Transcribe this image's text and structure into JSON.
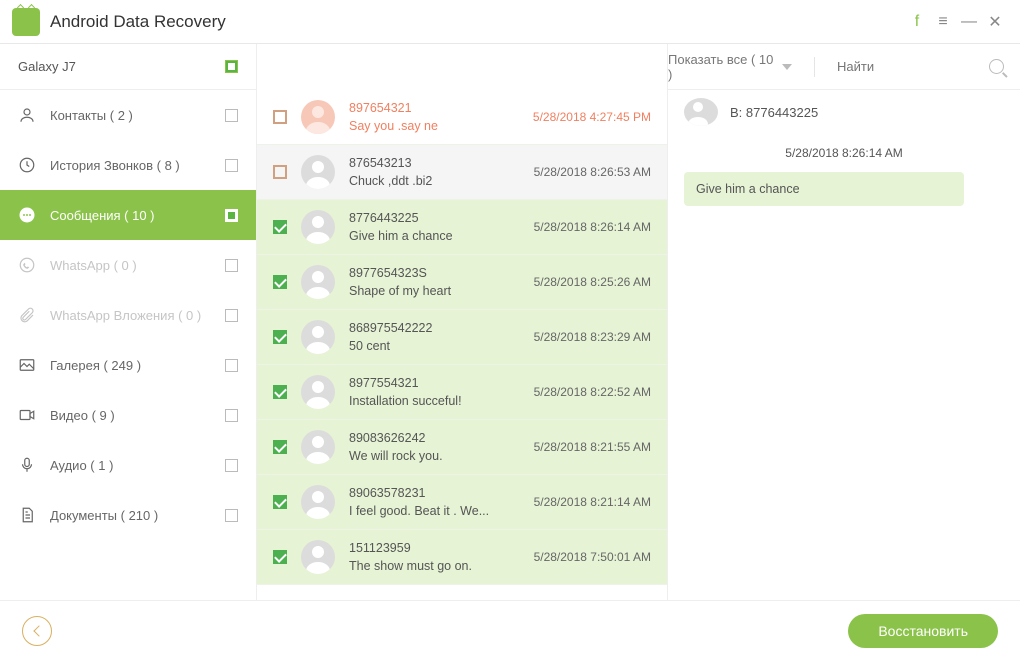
{
  "app": {
    "title": "Android Data Recovery"
  },
  "device": {
    "name": "Galaxy J7"
  },
  "filter": {
    "label": "Показать все ( 10 )"
  },
  "search": {
    "placeholder": "Найти"
  },
  "sidebar": {
    "items": [
      {
        "label": "Контакты ( 2 )",
        "checked": false,
        "disabled": false,
        "icon": "contacts"
      },
      {
        "label": "История Звонков ( 8 )",
        "checked": false,
        "disabled": false,
        "icon": "calllog"
      },
      {
        "label": "Сообщения ( 10 )",
        "checked": true,
        "disabled": false,
        "icon": "messages"
      },
      {
        "label": "WhatsApp ( 0 )",
        "checked": false,
        "disabled": true,
        "icon": "whatsapp"
      },
      {
        "label": "WhatsApp Вложения ( 0 )",
        "checked": false,
        "disabled": true,
        "icon": "attachment"
      },
      {
        "label": "Галерея ( 249 )",
        "checked": false,
        "disabled": false,
        "icon": "gallery"
      },
      {
        "label": "Видео ( 9 )",
        "checked": false,
        "disabled": false,
        "icon": "video"
      },
      {
        "label": "Аудио ( 1 )",
        "checked": false,
        "disabled": false,
        "icon": "audio"
      },
      {
        "label": "Документы ( 210 )",
        "checked": false,
        "disabled": false,
        "icon": "documents"
      }
    ]
  },
  "messages": [
    {
      "number": "897654321",
      "preview": "Say you .say ne",
      "time": "5/28/2018 4:27:45 PM",
      "checked": false,
      "deleted": true
    },
    {
      "number": "876543213",
      "preview": "Chuck ,ddt .bi2",
      "time": "5/28/2018 8:26:53 AM",
      "checked": false,
      "deleted": false
    },
    {
      "number": "8776443225",
      "preview": "Give him a chance",
      "time": "5/28/2018 8:26:14 AM",
      "checked": true,
      "deleted": false
    },
    {
      "number": "8977654323S",
      "preview": "Shape of my heart",
      "time": "5/28/2018 8:25:26 AM",
      "checked": true,
      "deleted": false
    },
    {
      "number": "868975542222",
      "preview": "50 cent",
      "time": "5/28/2018 8:23:29 AM",
      "checked": true,
      "deleted": false
    },
    {
      "number": "8977554321",
      "preview": "Installation  succeful!",
      "time": "5/28/2018 8:22:52 AM",
      "checked": true,
      "deleted": false
    },
    {
      "number": "89083626242",
      "preview": "We will rock you.",
      "time": "5/28/2018 8:21:55 AM",
      "checked": true,
      "deleted": false
    },
    {
      "number": "89063578231",
      "preview": "I feel good. Beat it . We...",
      "time": "5/28/2018 8:21:14 AM",
      "checked": true,
      "deleted": false
    },
    {
      "number": "151123959",
      "preview": "The show must go on.",
      "time": "5/28/2018 7:50:01 AM",
      "checked": true,
      "deleted": false
    }
  ],
  "conversation": {
    "title": "B: 8776443225",
    "time": "5/28/2018 8:26:14 AM",
    "bubble": "Give him a chance"
  },
  "footer": {
    "recover": "Восстановить"
  }
}
